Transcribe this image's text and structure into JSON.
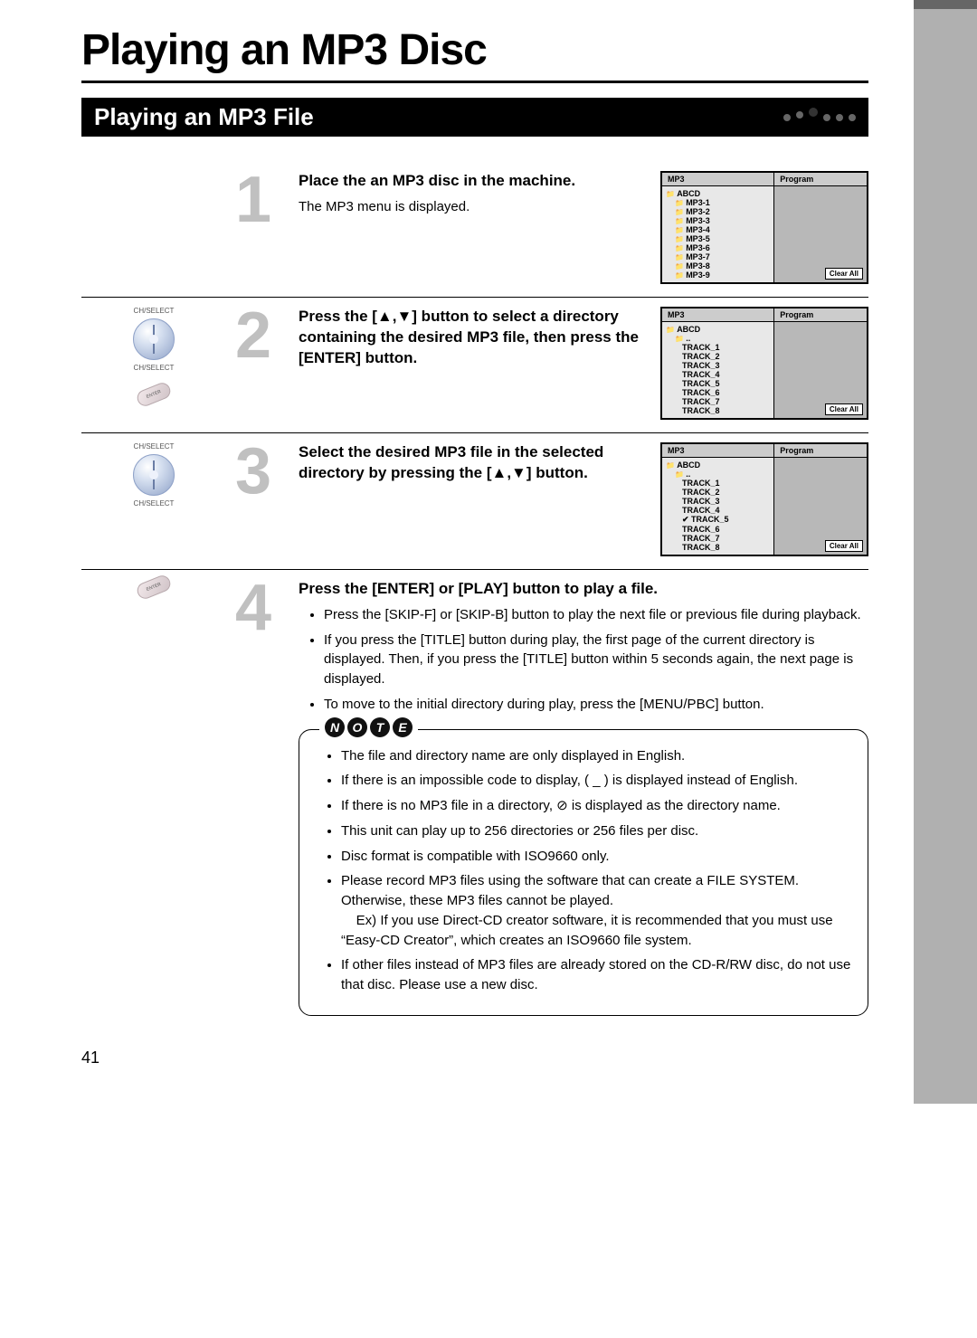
{
  "title": "Playing an MP3 Disc",
  "subtitle": "Playing an MP3 File",
  "page_number": "41",
  "side_labels": {
    "chselect": "CH/SELECT",
    "enter": "ENTER"
  },
  "steps": {
    "s1": {
      "num": "1",
      "head": "Place the an MP3 disc in the machine.",
      "body": "The MP3 menu is displayed."
    },
    "s2": {
      "num": "2",
      "head": "Press the [▲,▼] button to select a directory containing the desired MP3 file, then press the [ENTER] button."
    },
    "s3": {
      "num": "3",
      "head": "Select the desired MP3 file in the selected directory by pressing the [▲,▼] button."
    },
    "s4": {
      "num": "4",
      "head": "Press the [ENTER] or [PLAY] button to play a file.",
      "bullets": [
        "Press the [SKIP-F] or [SKIP-B]  button to play the next file or previous file during playback.",
        "If you press the [TITLE] button during play, the first page of the current directory is displayed. Then, if you press the [TITLE] button within 5 seconds again, the next page is displayed.",
        "To move to the initial directory during play, press the [MENU/PBC] button."
      ]
    }
  },
  "screens": {
    "hdr_left": "MP3",
    "hdr_right": "Program",
    "clear": "Clear All",
    "screen1": {
      "root": "ABCD",
      "items": [
        "MP3-1",
        "MP3-2",
        "MP3-3",
        "MP3-4",
        "MP3-5",
        "MP3-6",
        "MP3-7",
        "MP3-8",
        "MP3-9"
      ]
    },
    "screen2": {
      "root": "ABCD",
      "up": "..",
      "items": [
        "TRACK_1",
        "TRACK_2",
        "TRACK_3",
        "TRACK_4",
        "TRACK_5",
        "TRACK_6",
        "TRACK_7",
        "TRACK_8"
      ]
    },
    "screen3": {
      "root": "ABCD",
      "up": "..",
      "items": [
        "TRACK_1",
        "TRACK_2",
        "TRACK_3",
        "TRACK_4",
        "TRACK_5",
        "TRACK_6",
        "TRACK_7",
        "TRACK_8"
      ],
      "checked_index": 4
    }
  },
  "note": {
    "letters": [
      "N",
      "O",
      "T",
      "E"
    ],
    "items": [
      "The file and directory name are only displayed in English.",
      "If there is an impossible code to display, ( _ ) is displayed instead of English.",
      "If there is no MP3 file in a directory, ⊘ is displayed as the directory name.",
      "This unit can play up to 256 directories or 256 files per disc.",
      "Disc format is compatible with ISO9660 only.",
      "Please record MP3 files using the software that can create a FILE SYSTEM. Otherwise, these MP3 files cannot be played.\nEx) If you use Direct-CD creator software, it is recommended that you must use “Easy-CD Creator”, which creates an ISO9660 file system.",
      "If other files instead of MP3 files are already stored on the CD-R/RW disc, do not use that disc. Please use a new disc."
    ]
  }
}
